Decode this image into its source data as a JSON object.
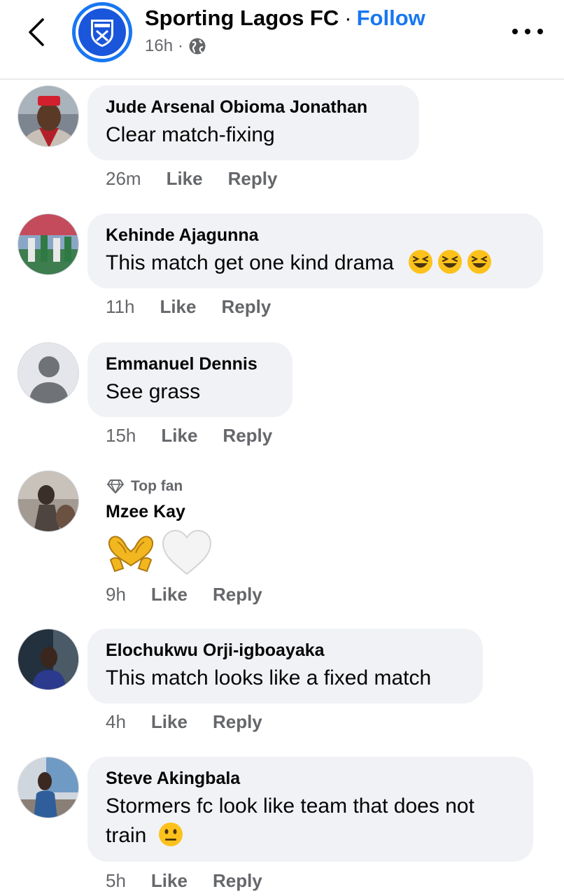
{
  "header": {
    "page_name": "Sporting Lagos FC",
    "separator": "·",
    "follow_label": "Follow",
    "time": "16h",
    "meta_separator": "·",
    "colors": {
      "accent": "#1877f2",
      "secondary_text": "#65676b",
      "bubble": "#f0f2f5"
    }
  },
  "comments": [
    {
      "author": "Jude Arsenal Obioma Jonathan",
      "text": "Clear match-fixing",
      "time": "26m",
      "like": "Like",
      "reply": "Reply"
    },
    {
      "author": "Kehinde Ajagunna",
      "text": "This match get one kind drama",
      "emojis": [
        "laughing-face",
        "laughing-face",
        "laughing-face"
      ],
      "time": "11h",
      "like": "Like",
      "reply": "Reply"
    },
    {
      "author": "Emmanuel Dennis",
      "text": "See grass",
      "time": "15h",
      "like": "Like",
      "reply": "Reply"
    },
    {
      "badge": "Top fan",
      "author": "Mzee Kay",
      "emojis": [
        "heart-hands",
        "white-heart"
      ],
      "time": "9h",
      "like": "Like",
      "reply": "Reply"
    },
    {
      "author": "Elochukwu Orji-igboayaka",
      "text": "This match looks like a fixed match",
      "time": "4h",
      "like": "Like",
      "reply": "Reply"
    },
    {
      "author": "Steve Akingbala",
      "text_line1": "Stormers fc look like team that does not",
      "text_line2": "train",
      "emojis": [
        "neutral-face"
      ],
      "time": "5h",
      "like": "Like",
      "reply": "Reply"
    }
  ]
}
